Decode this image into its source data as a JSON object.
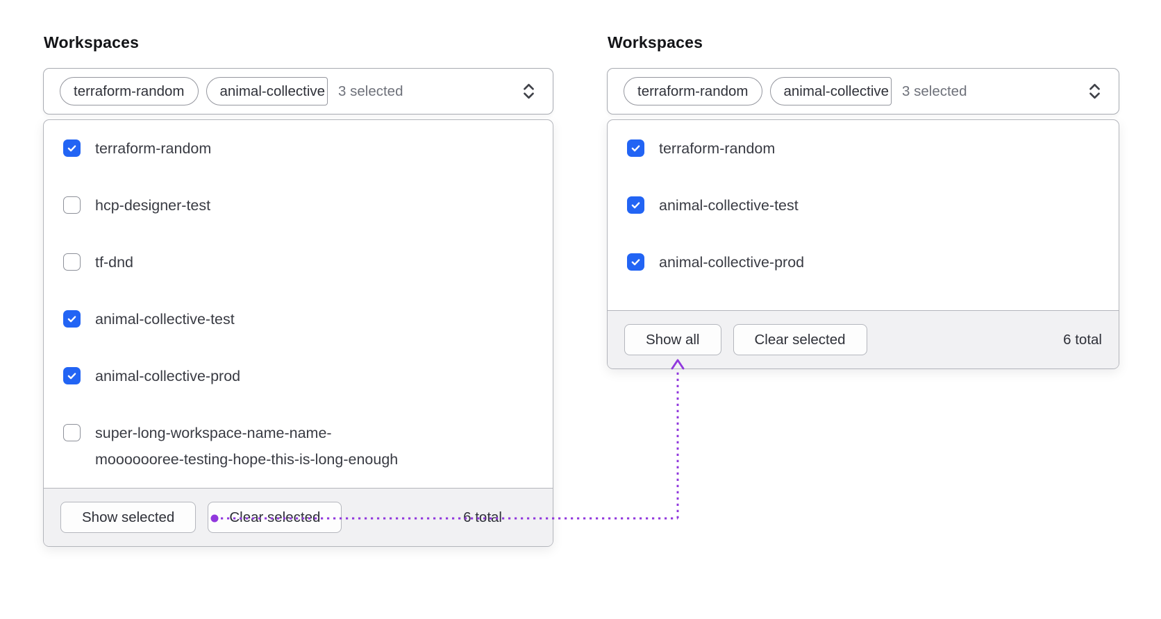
{
  "colors": {
    "checkbox_checked_blue": "#2264f4",
    "annotation_purple": "#9138dd",
    "footer_background": "#f1f1f3",
    "card_border": "#b3b5bb"
  },
  "annotation": {
    "type": "dotted-connector",
    "from": "show-selected-button",
    "to": "show-all-button"
  },
  "panels": [
    {
      "title": "Workspaces",
      "select": {
        "tags": [
          "terraform-random",
          "animal-collective"
        ],
        "summary": "3 selected"
      },
      "items": [
        {
          "label": "terraform-random",
          "checked": true
        },
        {
          "label": "hcp-designer-test",
          "checked": false
        },
        {
          "label": "tf-dnd",
          "checked": false
        },
        {
          "label": "animal-collective-test",
          "checked": true
        },
        {
          "label": "animal-collective-prod",
          "checked": true
        },
        {
          "label": "super-long-workspace-name-name-",
          "label2": "mooooooree-testing-hope-this-is-long-enough",
          "checked": false
        }
      ],
      "footer": {
        "primary_button": "Show selected",
        "secondary_button": "Clear selected",
        "total": "6 total"
      }
    },
    {
      "title": "Workspaces",
      "select": {
        "tags": [
          "terraform-random",
          "animal-collective"
        ],
        "summary": "3 selected"
      },
      "items": [
        {
          "label": "terraform-random",
          "checked": true
        },
        {
          "label": "animal-collective-test",
          "checked": true
        },
        {
          "label": "animal-collective-prod",
          "checked": true
        }
      ],
      "footer": {
        "primary_button": "Show all",
        "secondary_button": "Clear selected",
        "total": "6 total"
      }
    }
  ]
}
